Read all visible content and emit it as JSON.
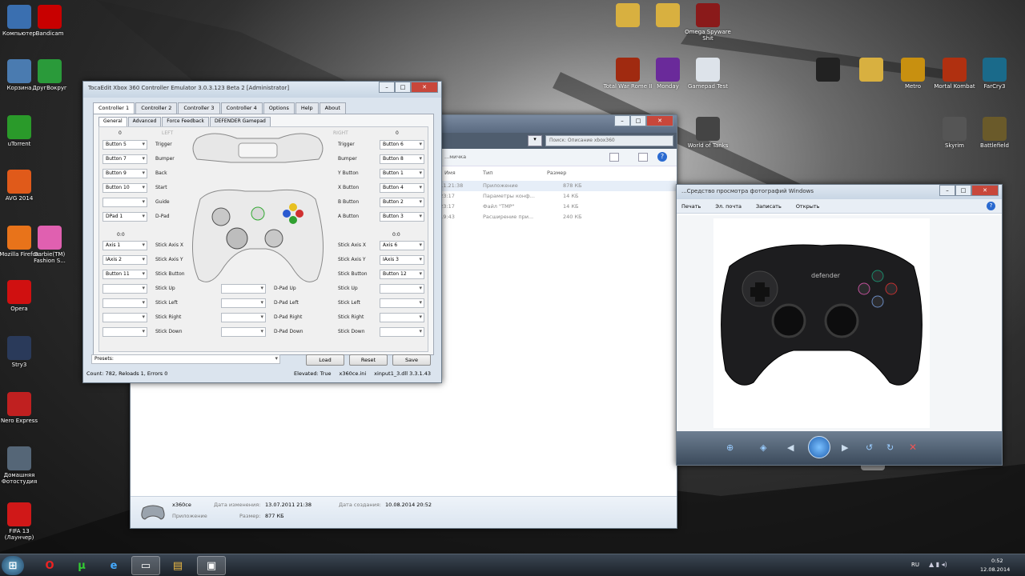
{
  "desktop_left": [
    {
      "name": "Компьютер",
      "icon": "computer-icon",
      "color": "#3a6fb0"
    },
    {
      "name": "Bandicam",
      "icon": "record-icon",
      "color": "#c80000"
    },
    {
      "name": "Корзина",
      "icon": "recycle-bin-icon",
      "color": "#4a7bb0"
    },
    {
      "name": "ДругВокруг",
      "icon": "clover-icon",
      "color": "#2a9a3a"
    },
    {
      "name": "uTorrent",
      "icon": "utorrent-icon",
      "color": "#2a9a2a"
    },
    {
      "name": "AVG 2014",
      "icon": "avg-icon",
      "color": "#e05a1a"
    },
    {
      "name": "Mozilla Firefox",
      "icon": "firefox-icon",
      "color": "#e8731a"
    },
    {
      "name": "Barbie(TM) Fashion S...",
      "icon": "barbie-icon",
      "color": "#e060b0"
    },
    {
      "name": "Opera",
      "icon": "opera-icon",
      "color": "#d01010"
    },
    {
      "name": "Stry3",
      "icon": "stry-icon",
      "color": "#2a3a5a"
    },
    {
      "name": "Nero Express",
      "icon": "nero-icon",
      "color": "#c02020"
    },
    {
      "name": "Домашняя Фотостудия",
      "icon": "camera-icon",
      "color": "#556677"
    },
    {
      "name": "FIFA 13 (Лаунчер)",
      "icon": "fifa-icon",
      "color": "#d01818"
    }
  ],
  "desktop_right": [
    {
      "name": "",
      "icon": "folder-icon",
      "color": "#d8b040"
    },
    {
      "name": "",
      "icon": "folder-icon",
      "color": "#d8b040"
    },
    {
      "name": "Omega Spyware Shit",
      "icon": "omega-icon",
      "color": "#8a1a1a"
    },
    {
      "name": "Total War Rome II",
      "icon": "rome-icon",
      "color": "#a02a10"
    },
    {
      "name": "Monday",
      "icon": "purple-icon",
      "color": "#6a2a9a"
    },
    {
      "name": "Gamepad Test",
      "icon": "doc-icon",
      "color": "#dde3ea"
    },
    {
      "name": "",
      "icon": "gamepad-icon",
      "color": "#222"
    },
    {
      "name": "",
      "icon": "folder-icon",
      "color": "#d8b040"
    },
    {
      "name": "Metro",
      "icon": "metro-icon",
      "color": "#c89010"
    },
    {
      "name": "Mortal Kombat",
      "icon": "mk-icon",
      "color": "#b03010"
    },
    {
      "name": "FarCry3",
      "icon": "fc3-icon",
      "color": "#1a6a8a"
    },
    {
      "name": "World of Tanks",
      "icon": "tank-icon",
      "color": "#444"
    },
    {
      "name": "Skyrim",
      "icon": "skyrim-icon",
      "color": "#555"
    },
    {
      "name": "Battlefield",
      "icon": "badge-icon",
      "color": "#6a5a2a"
    },
    {
      "name": "",
      "icon": "ghost-icon",
      "color": "#888"
    }
  ],
  "x360ce": {
    "title": "TocaEdit Xbox 360 Controller Emulator 3.0.3.123 Beta 2 [Administrator]",
    "tabs": [
      "Controller 1",
      "Controller 2",
      "Controller 3",
      "Controller 4",
      "Options",
      "Help",
      "About"
    ],
    "subtabs": [
      "General",
      "Advanced",
      "Force Feedback",
      "DEFENDER Gamepad"
    ],
    "left_header": "LEFT",
    "right_header": "RIGHT",
    "zero": "0",
    "zero2": "0",
    "dz_left": "0:0",
    "dz_right": "0:0",
    "left_rows": [
      {
        "value": "Button 5",
        "label": "Trigger"
      },
      {
        "value": "Button 7",
        "label": "Bumper"
      },
      {
        "value": "Button 9",
        "label": "Back"
      },
      {
        "value": "Button 10",
        "label": "Start"
      },
      {
        "value": "",
        "label": "Guide"
      },
      {
        "value": "DPad 1",
        "label": "D-Pad"
      }
    ],
    "right_rows": [
      {
        "label": "Trigger",
        "value": "Button 6"
      },
      {
        "label": "Bumper",
        "value": "Button 8"
      },
      {
        "label": "Y Button",
        "value": "Button 1"
      },
      {
        "label": "X Button",
        "value": "Button 4"
      },
      {
        "label": "B Button",
        "value": "Button 2"
      },
      {
        "label": "A Button",
        "value": "Button 3"
      }
    ],
    "stick_left": [
      {
        "value": "Axis 1",
        "label": "Stick Axis X"
      },
      {
        "value": "IAxis 2",
        "label": "Stick Axis Y"
      },
      {
        "value": "Button 11",
        "label": "Stick Button"
      }
    ],
    "stick_right": [
      {
        "label": "Stick Axis X",
        "value": "Axis 6"
      },
      {
        "label": "Stick Axis Y",
        "value": "IAxis 3"
      },
      {
        "label": "Stick Button",
        "value": "Button 12"
      }
    ],
    "dir_left": [
      "Stick Up",
      "Stick Left",
      "Stick Right",
      "Stick Down"
    ],
    "dpad": [
      "D-Pad Up",
      "D-Pad Left",
      "D-Pad Right",
      "D-Pad Down"
    ],
    "dir_right": [
      "Stick Up",
      "Stick Left",
      "Stick Right",
      "Stick Down"
    ],
    "presets_placeholder": "Presets:",
    "load": "Load",
    "reset": "Reset",
    "save": "Save",
    "status_left": "Count: 782, Reloads 1, Errors 0",
    "elevated": "Elevated: True",
    "ini": "x360ce.ini",
    "dll": "xinput1_3.dll 3.3.1.43"
  },
  "explorer": {
    "search_placeholder": "Поиск: Описание xbox360",
    "breadcrumb": "...мичка",
    "col_name": "Имя",
    "col_type": "Тип",
    "col_size": "Размер",
    "rows": [
      {
        "date": "...11.21:38",
        "type": "Приложение",
        "size": "878 КБ"
      },
      {
        "date": "...23:17",
        "type": "Параметры конф...",
        "size": "14 КБ"
      },
      {
        "date": "...23:17",
        "type": "Файл \"TMP\"",
        "size": "14 КБ"
      },
      {
        "date": "...19:43",
        "type": "Расширение при...",
        "size": "240 КБ"
      }
    ],
    "file_name": "x360ce",
    "file_type": "Приложение",
    "modified_label": "Дата изменения:",
    "modified": "13.07.2011 21:38",
    "size_label": "Размер:",
    "size": "877 КБ",
    "created_label": "Дата создания:",
    "created": "10.08.2014 20:52"
  },
  "viewer": {
    "title": "...Средство просмотра фотографий Windows",
    "menu": [
      "Печать",
      "Эл. почта",
      "Записать",
      "Открыть"
    ],
    "brand": "defender"
  },
  "taskbar": {
    "lang": "RU",
    "time": "0:52",
    "date": "12.08.2014"
  }
}
